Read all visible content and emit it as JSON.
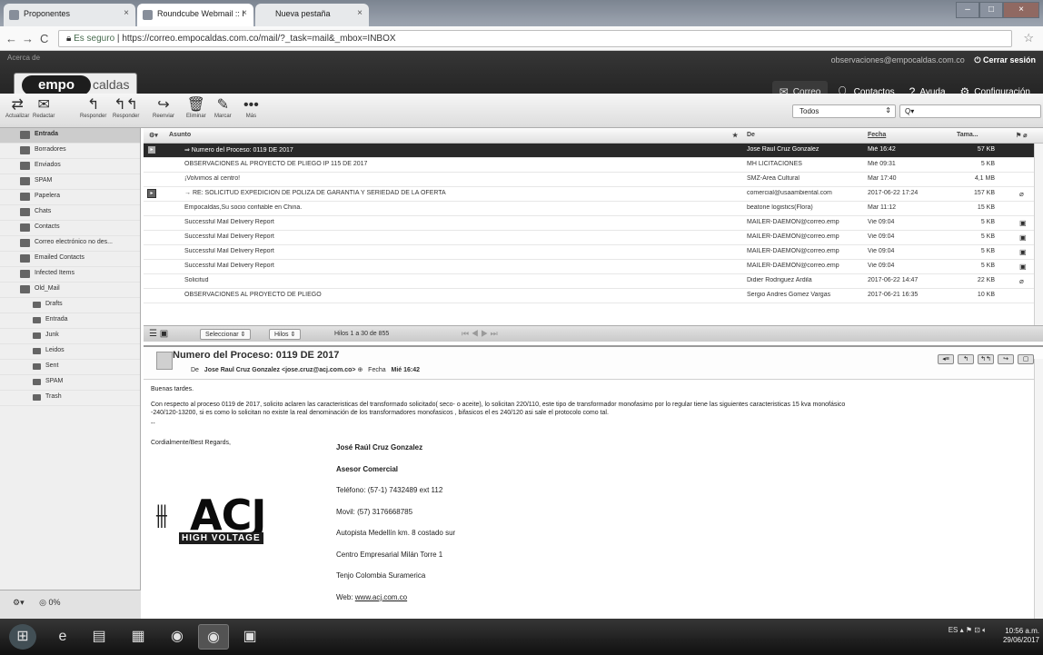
{
  "browser": {
    "tabs": [
      {
        "label": "Proponentes"
      },
      {
        "label": "Roundcube Webmail :: I"
      },
      {
        "label": "Nueva pestaña"
      }
    ],
    "secure_label": "Es seguro",
    "url": "https://correo.empocaldas.com.co/mail/?_task=mail&_mbox=INBOX"
  },
  "header": {
    "about": "Acerca de",
    "logo_main": "empo",
    "logo_rest": "caldas",
    "user_email": "observaciones@empocaldas.com.co",
    "logout": "Cerrar sesión",
    "nav": [
      {
        "label": "Correo",
        "icon": "mail-icon"
      },
      {
        "label": "Contactos",
        "icon": "person-icon"
      },
      {
        "label": "Ayuda",
        "icon": "help-icon"
      },
      {
        "label": "Configuración",
        "icon": "gear-icon"
      }
    ]
  },
  "toolbar": {
    "buttons": [
      {
        "label": "Actualizar",
        "icon": "refresh-icon"
      },
      {
        "label": "Redactar",
        "icon": "compose-icon"
      },
      {
        "label": "Responder",
        "icon": "reply-icon"
      },
      {
        "label": "Responder",
        "icon": "reply-all-icon"
      },
      {
        "label": "Reenviar",
        "icon": "forward-icon"
      },
      {
        "label": "Eliminar",
        "icon": "trash-icon"
      },
      {
        "label": "Marcar",
        "icon": "mark-icon"
      },
      {
        "label": "Más",
        "icon": "more-icon"
      }
    ],
    "filter": "Todos",
    "search_placeholder": "Q▾"
  },
  "folders": [
    {
      "label": "Entrada"
    },
    {
      "label": "Borradores"
    },
    {
      "label": "Enviados"
    },
    {
      "label": "SPAM"
    },
    {
      "label": "Papelera"
    },
    {
      "label": "Chats"
    },
    {
      "label": "Contacts"
    },
    {
      "label": "Correo electrónico no des..."
    },
    {
      "label": "Emailed Contacts"
    },
    {
      "label": "Infected Items"
    },
    {
      "label": "Old_Mail"
    },
    {
      "label": "Drafts"
    },
    {
      "label": "Entrada"
    },
    {
      "label": "Junk"
    },
    {
      "label": "Leidos"
    },
    {
      "label": "Sent"
    },
    {
      "label": "SPAM"
    },
    {
      "label": "Trash"
    }
  ],
  "quota": "0%",
  "list": {
    "columns": {
      "subject": "Asunto",
      "from": "De",
      "date": "Fecha",
      "size": "Tama..."
    },
    "rows": [
      {
        "subject": "⇒ Numero del Proceso: 0119 DE 2017",
        "from": "Jose Raul Cruz Gonzalez",
        "date": "Mié 16:42",
        "size": "57 KB",
        "extra": ""
      },
      {
        "subject": "OBSERVACIONES AL PROYECTO DE PLIEGO IP 115 DE 2017",
        "from": "MH LICITACIONES",
        "date": "Mié 09:31",
        "size": "5 KB",
        "extra": ""
      },
      {
        "subject": "¡Volvimos al centro!",
        "from": "SMZ-Area Cultural",
        "date": "Mar 17:40",
        "size": "4,1 MB",
        "extra": ""
      },
      {
        "subject": "→ RE: SOLICITUD EXPEDICIÓN DE POLIZA DE GARANTIA Y SERIEDAD DE LA OFERTA",
        "from": "comercial@usaambiental.com",
        "date": "2017-06-22 17:24",
        "size": "157 KB",
        "extra": "⌀"
      },
      {
        "subject": "Empocaldas,Su socio confiable en China.",
        "from": "beatone logistics(Flora)",
        "date": "Mar 11:12",
        "size": "15 KB",
        "extra": ""
      },
      {
        "subject": "Successful Mail Delivery Report",
        "from": "MAILER-DAEMON@correo.emp",
        "date": "Vie 09:04",
        "size": "5 KB",
        "extra": "▣"
      },
      {
        "subject": "Successful Mail Delivery Report",
        "from": "MAILER-DAEMON@correo.emp",
        "date": "Vie 09:04",
        "size": "5 KB",
        "extra": "▣"
      },
      {
        "subject": "Successful Mail Delivery Report",
        "from": "MAILER-DAEMON@correo.emp",
        "date": "Vie 09:04",
        "size": "5 KB",
        "extra": "▣"
      },
      {
        "subject": "Successful Mail Delivery Report",
        "from": "MAILER-DAEMON@correo.emp",
        "date": "Vie 09:04",
        "size": "5 KB",
        "extra": "▣"
      },
      {
        "subject": "Solicitud",
        "from": "Didier Rodriguez Ardila",
        "date": "2017-06-22 14:47",
        "size": "22 KB",
        "extra": "⌀"
      },
      {
        "subject": "OBSERVACIONES AL PROYECTO DE PLIEGO",
        "from": "Sergio Andres Gomez Vargas",
        "date": "2017-06-21 16:35",
        "size": "10 KB",
        "extra": ""
      }
    ],
    "footer": {
      "select": "Seleccionar ⇕",
      "threads": "Hilos ⇕",
      "count": "Hilos 1 a 30 de 855"
    }
  },
  "message": {
    "subject": "Numero del Proceso: 0119 DE 2017",
    "from_label": "De",
    "from": "Jose Raul Cruz Gonzalez <jose.cruz@acj.com.co>",
    "date_label": "Fecha",
    "date": "Mié 16:42",
    "greeting": "Buenas tardes.",
    "body1": "Con respecto al proceso 0119 de 2017, solicito aclaren las caracteristicas  del transformado solicitado( seco- o aceite), lo solicitan 220/110, este tipo de transformador monofasimo por lo regular tiene las siguientes caracteristicas 15 kva monofásico",
    "body2": "-240/120-13200, si es como lo solicitan  no existe la real denominación de los transformadores monofasicos , bifasicos el es 240/120 asi sale el protocolo como tal.",
    "sep": "--",
    "regards": "Cordialmente/Best Regards,",
    "signature": {
      "name": "José Raúl Cruz Gonzalez",
      "role": "Asesor Comercial",
      "phone": "Teléfono: (57-1) 7432489 ext 112",
      "mobile": "Movil: (57) 3176668785",
      "address": "Autopista Medellín km. 8 costado sur",
      "building": "Centro Empresarial Milán Torre 1",
      "city": "Tenjo Colombia Suramerica",
      "web_label": "Web:",
      "web": "www.acj.com.co"
    },
    "logo_text": "ACJ",
    "logo_sub": "HIGH VOLTAGE"
  },
  "taskbar": {
    "lang": "ES",
    "time": "10:56 a.m.",
    "date": "29/06/2017"
  }
}
